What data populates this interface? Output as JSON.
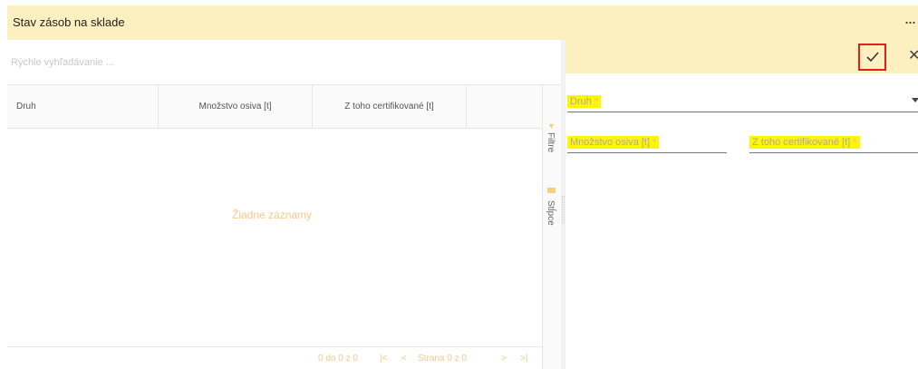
{
  "header": {
    "title": "Stav zásob na sklade",
    "more_label": "..."
  },
  "grid": {
    "search": {
      "placeholder": "Rýchle vyhľadávanie ...",
      "value": ""
    },
    "columns": [
      "Druh",
      "Množstvo osiva [t]",
      "Z toho certifikované [t]",
      ""
    ],
    "empty_message": "Žiadne záznamy",
    "side_tabs": {
      "filters": "Filtre",
      "columns": "Stĺpce"
    },
    "pager": {
      "range": "0 do 0 z 0",
      "first": "|<",
      "prev": "<",
      "page_label": "Strana 0 z 0",
      "next": ">",
      "last": ">|"
    }
  },
  "detail": {
    "toolbar": {
      "confirm_icon": "checkmark-icon",
      "close_label": "✕"
    },
    "fields": {
      "druh": {
        "label": "Druh",
        "required": "*"
      },
      "mnozstvo": {
        "label": "Množstvo osiva [t]",
        "required": "*"
      },
      "certifikovane": {
        "label": "Z toho certifikované [t]",
        "required": "*"
      }
    }
  },
  "colors": {
    "accent": "#fdf0c0",
    "highlight": "#fff600",
    "empty_text": "#f5c98b",
    "focus_outline": "#e02020"
  }
}
